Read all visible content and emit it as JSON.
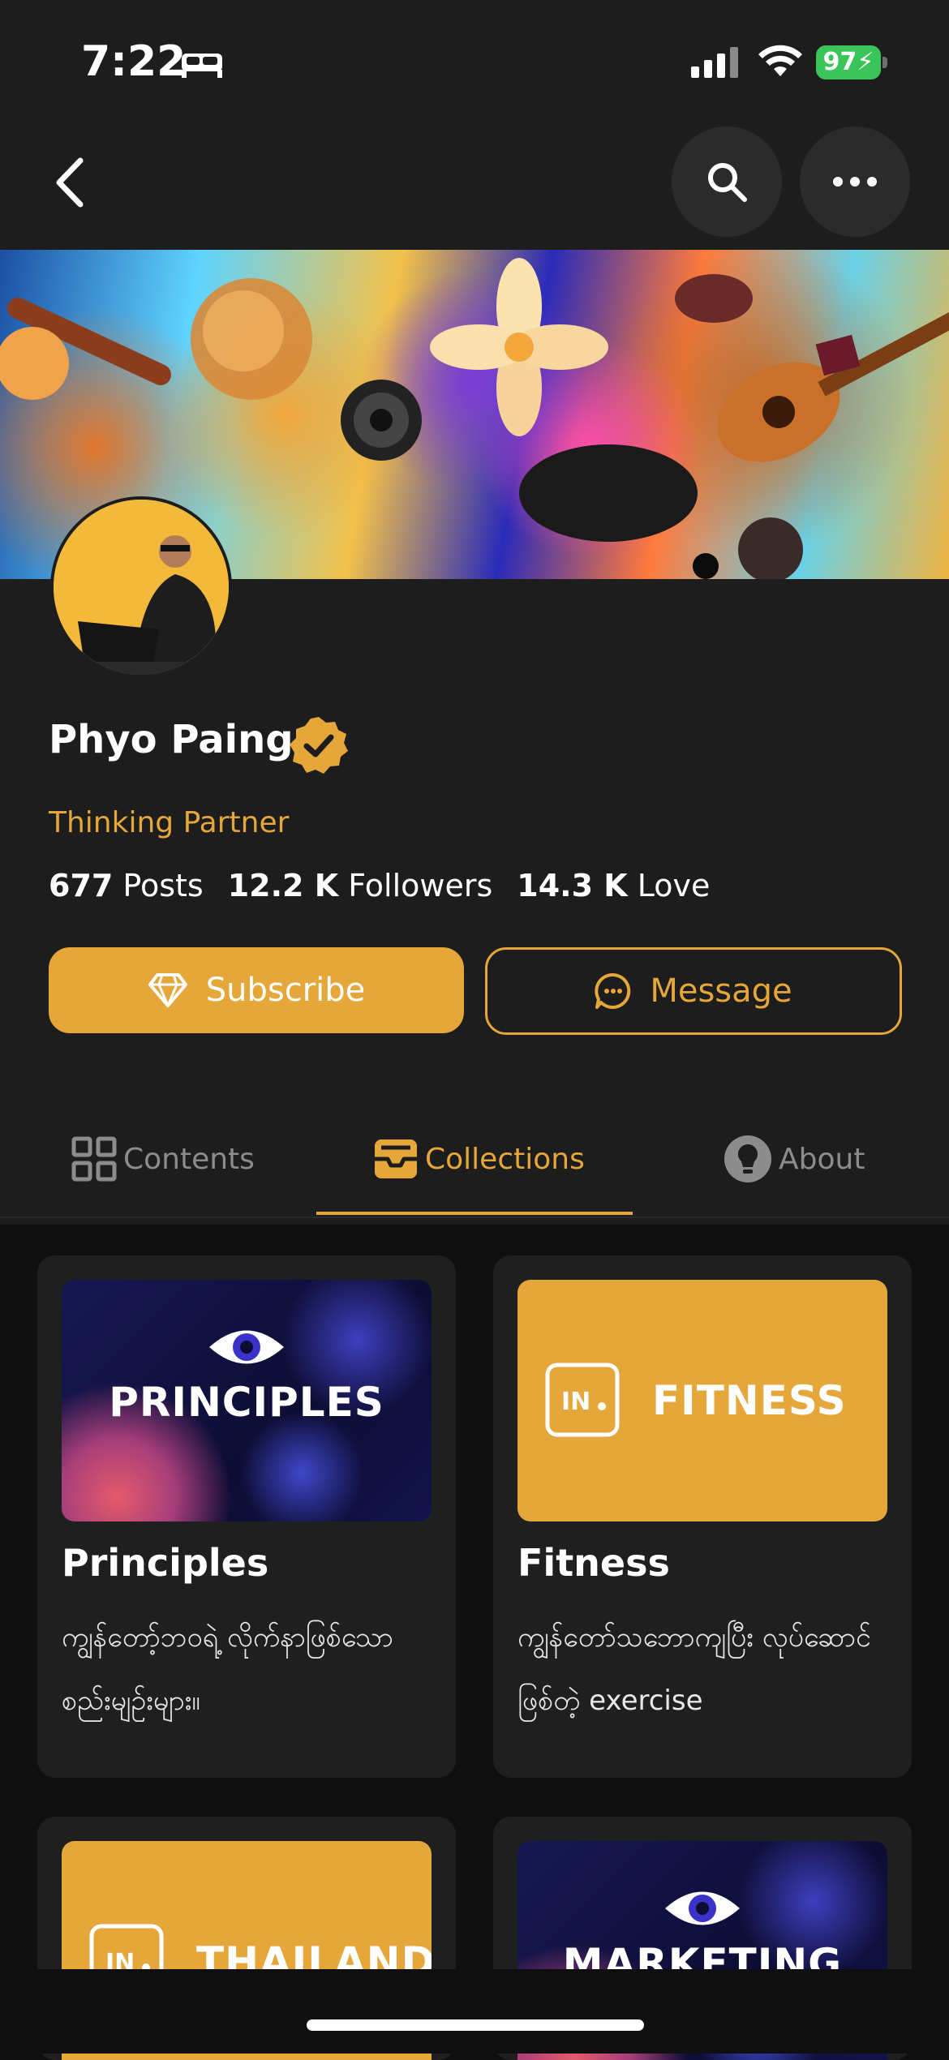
{
  "status_bar": {
    "time": "7:22",
    "battery": "97"
  },
  "profile": {
    "name": "Phyo Paing",
    "tagline": "Thinking Partner",
    "stats": [
      {
        "value": "677",
        "label": "Posts"
      },
      {
        "value": "12.2 K",
        "label": "Followers"
      },
      {
        "value": "14.3 K",
        "label": "Love"
      }
    ]
  },
  "actions": {
    "subscribe_label": "Subscribe",
    "message_label": "Message"
  },
  "tabs": [
    {
      "label": "Contents",
      "active": false
    },
    {
      "label": "Collections",
      "active": true
    },
    {
      "label": "About",
      "active": false
    }
  ],
  "collections": [
    {
      "thumb_title": "PRINCIPLES",
      "title": "Principles",
      "description": "ကျွန်တော့်ဘဝရဲ့ လိုက်နာဖြစ်သော စည်းမျဉ်းများ။"
    },
    {
      "thumb_title": "FITNESS",
      "title": "Fitness",
      "description": "ကျွန်တော်သဘောကျပြီး လုပ်ဆောင်ဖြစ်တဲ့ exercise"
    },
    {
      "thumb_title": "THAILAND",
      "title": "",
      "description": ""
    },
    {
      "thumb_title": "MARKETING",
      "title": "",
      "description": ""
    }
  ],
  "colors": {
    "accent": "#e5a63a",
    "background": "#1d1d1d"
  }
}
